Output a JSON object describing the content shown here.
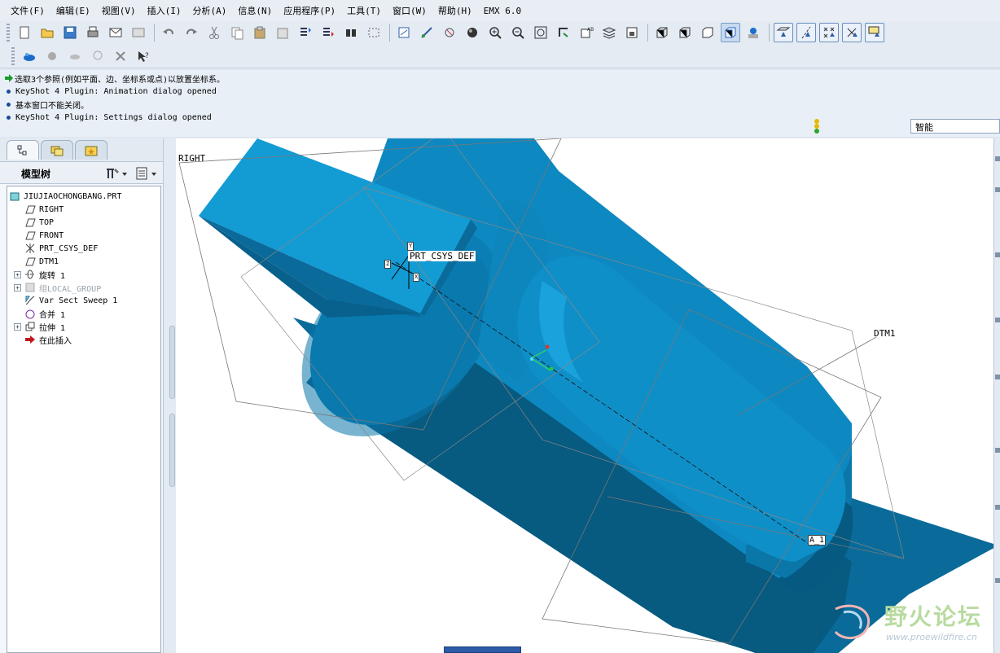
{
  "menu": [
    "文件(F)",
    "编辑(E)",
    "视图(V)",
    "插入(I)",
    "分析(A)",
    "信息(N)",
    "应用程序(P)",
    "工具(T)",
    "窗口(W)",
    "帮助(H)",
    "EMX 6.0"
  ],
  "messages": [
    {
      "type": "prompt",
      "text": "选取3个参照(例如平面、边、坐标系或点)以放置坐标系。"
    },
    {
      "type": "info",
      "text": "KeyShot 4 Plugin: Animation dialog opened"
    },
    {
      "type": "info",
      "text": "基本窗口不能关闭。"
    },
    {
      "type": "info",
      "text": "KeyShot 4 Plugin: Settings dialog opened"
    }
  ],
  "filter": {
    "value": "智能"
  },
  "model_tree": {
    "title": "模型树",
    "root": "JIUJIAOCHONGBANG.PRT",
    "items": [
      {
        "label": "RIGHT",
        "icon": "datum-plane-icon",
        "expandable": false,
        "dim": false
      },
      {
        "label": "TOP",
        "icon": "datum-plane-icon",
        "expandable": false,
        "dim": false
      },
      {
        "label": "FRONT",
        "icon": "datum-plane-icon",
        "expandable": false,
        "dim": false
      },
      {
        "label": "PRT_CSYS_DEF",
        "icon": "csys-icon",
        "expandable": false,
        "dim": false
      },
      {
        "label": "DTM1",
        "icon": "datum-plane-icon",
        "expandable": false,
        "dim": false
      },
      {
        "label": "旋转 1",
        "icon": "revolve-icon",
        "expandable": true,
        "dim": false
      },
      {
        "label": "组LOCAL_GROUP",
        "icon": "group-icon",
        "expandable": true,
        "dim": true
      },
      {
        "label": "Var Sect Sweep 1",
        "icon": "sweep-icon",
        "expandable": false,
        "dim": false
      },
      {
        "label": "合并 1",
        "icon": "merge-icon",
        "expandable": false,
        "dim": false
      },
      {
        "label": "拉伸 1",
        "icon": "extrude-icon",
        "expandable": true,
        "dim": false
      },
      {
        "label": "在此插入",
        "icon": "insert-here-icon",
        "expandable": false,
        "dim": false
      }
    ]
  },
  "viewport": {
    "labels": {
      "right": "RIGHT",
      "dtm1": "DTM1",
      "csys": "PRT_CSYS_DEF",
      "axis": "A_1",
      "csys_x": "X",
      "csys_y": "Y",
      "csys_z": "Z"
    },
    "model_color": "#0f86bd"
  },
  "watermark": {
    "text": "野火论坛",
    "url": "www.proewildfire.cn"
  },
  "colors": {
    "menubar": "#e9eef5",
    "toolbar": "#e4ebf3",
    "panel": "#e3eaf2",
    "model_light": "#139bd4",
    "model_dark": "#075a80"
  }
}
